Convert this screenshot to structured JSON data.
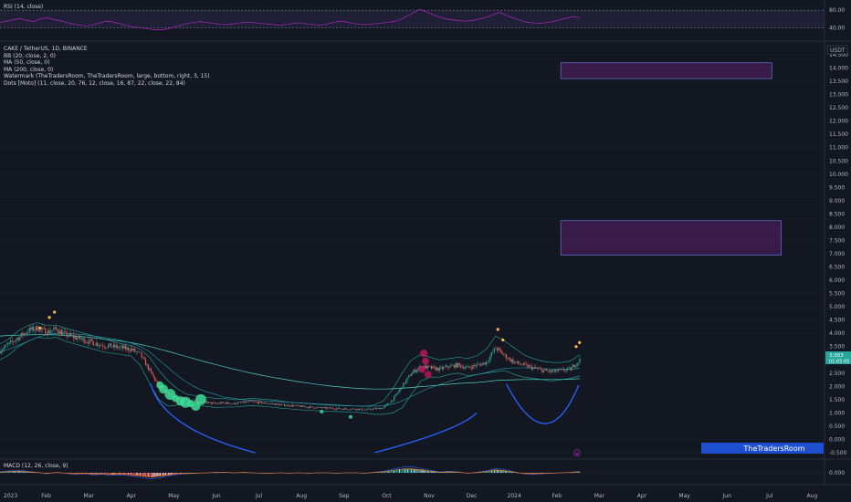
{
  "colors": {
    "bg": "#131722",
    "text": "#b2b5be",
    "up": "#26a69a",
    "down": "#ef5350",
    "rsi_line": "#9c27b0",
    "rsi_band": "#7e57c2",
    "bb": "#26a69a",
    "ma": "#2196f3",
    "zone": "#9c27b0",
    "watermark_bg": "#1e4fd0"
  },
  "rsi": {
    "title": "RSI (14, close)",
    "scale": [
      "80.00",
      "40.00"
    ],
    "upper": 80,
    "lower": 40,
    "values": [
      52,
      55,
      58,
      61,
      57,
      54,
      60,
      63,
      59,
      56,
      52,
      48,
      46,
      44,
      47,
      51,
      55,
      53,
      49,
      45,
      42,
      40,
      38,
      36,
      35,
      37,
      41,
      45,
      49,
      52,
      54,
      52,
      50,
      48,
      47,
      49,
      51,
      53,
      52,
      50,
      49,
      47,
      46,
      48,
      50,
      51,
      49,
      47,
      46,
      48,
      52,
      55,
      53,
      50,
      48,
      47,
      49,
      50,
      52,
      54,
      58,
      66,
      74,
      82,
      76,
      70,
      64,
      60,
      58,
      56,
      55,
      57,
      60,
      64,
      70,
      75,
      68,
      62,
      57,
      53,
      51,
      50,
      52,
      54,
      58,
      62,
      65,
      63
    ]
  },
  "price_pane": {
    "symbol": "CAKE / TetherUS, 1D, BINANCE",
    "indicators": [
      "BB (20, close, 2, 0)",
      "MA (50, close, 0)",
      "MA (200, close, 0)",
      "Watermark (TheTradersRoom, TheTradersRoom, large, bottom, right, 3, 15)",
      "Dots [Moto] (11, close, 20, 76, 12, close, 16, 87, 22, close, 22, 84)"
    ],
    "currency": "USDT",
    "price_ticks": [
      "14.500",
      "14.000",
      "13.500",
      "13.000",
      "12.500",
      "12.000",
      "11.500",
      "11.000",
      "10.500",
      "10.000",
      "9.500",
      "9.000",
      "8.500",
      "8.000",
      "7.500",
      "7.000",
      "6.500",
      "6.000",
      "5.500",
      "5.000",
      "4.500",
      "4.000",
      "3.500",
      "3.000",
      "2.500",
      "2.000",
      "1.500",
      "1.000",
      "0.500",
      "0.000",
      "-0.500"
    ],
    "last_price": "3.003",
    "countdown": "01:05:05",
    "watermark": "TheTradersRoom"
  },
  "macd": {
    "title": "MACD (12, 26, close, 9)",
    "scale": [
      "0.000"
    ]
  },
  "x_axis": {
    "labels": [
      "2023",
      "Feb",
      "Mar",
      "Apr",
      "May",
      "Jun",
      "Jul",
      "Aug",
      "Sep",
      "Oct",
      "Nov",
      "Dec",
      "2024",
      "Feb",
      "Mar",
      "Apr",
      "May",
      "Jun",
      "Jul",
      "Aug"
    ]
  },
  "chart_data": {
    "type": "candlestick",
    "symbol": "CAKE / TetherUS",
    "interval": "1D",
    "exchange": "BINANCE",
    "ylim": [
      -0.6,
      14.6
    ],
    "x_ticks": [
      "2023",
      "Feb",
      "Mar",
      "Apr",
      "May",
      "Jun",
      "Jul",
      "Aug",
      "Sep",
      "Oct",
      "Nov",
      "Dec",
      "2024",
      "Feb",
      "Mar",
      "Apr",
      "May",
      "Jun",
      "Jul",
      "Aug"
    ],
    "close_weekly": [
      3.35,
      3.6,
      3.85,
      4.1,
      4.2,
      4.05,
      4.15,
      3.95,
      3.85,
      3.75,
      3.65,
      3.55,
      3.5,
      3.45,
      3.4,
      3.2,
      2.6,
      2.0,
      1.7,
      1.6,
      1.5,
      1.45,
      1.4,
      1.35,
      1.38,
      1.35,
      1.4,
      1.42,
      1.38,
      1.35,
      1.3,
      1.28,
      1.25,
      1.22,
      1.2,
      1.18,
      1.17,
      1.15,
      1.15,
      1.12,
      1.15,
      1.2,
      1.5,
      2.0,
      2.5,
      2.75,
      2.7,
      2.65,
      2.75,
      2.8,
      2.7,
      2.8,
      2.9,
      3.45,
      3.15,
      2.9,
      2.8,
      2.7,
      2.6,
      2.55,
      2.6,
      2.65,
      3.0
    ],
    "bb_upper_weekly": [
      3.6,
      3.8,
      4.1,
      4.3,
      4.4,
      4.3,
      4.3,
      4.2,
      4.1,
      4.0,
      3.9,
      3.8,
      3.7,
      3.6,
      3.55,
      3.4,
      3.1,
      2.6,
      2.2,
      1.9,
      1.7,
      1.65,
      1.6,
      1.55,
      1.55,
      1.5,
      1.52,
      1.55,
      1.52,
      1.5,
      1.45,
      1.4,
      1.38,
      1.35,
      1.32,
      1.3,
      1.28,
      1.27,
      1.26,
      1.25,
      1.3,
      1.45,
      1.9,
      2.5,
      3.0,
      3.2,
      3.1,
      3.0,
      3.05,
      3.1,
      3.05,
      3.15,
      3.4,
      3.9,
      3.7,
      3.45,
      3.2,
      3.05,
      2.95,
      2.9,
      2.9,
      2.95,
      3.2
    ],
    "bb_lower_weekly": [
      3.0,
      3.2,
      3.5,
      3.7,
      3.85,
      3.8,
      3.85,
      3.7,
      3.6,
      3.5,
      3.4,
      3.3,
      3.25,
      3.2,
      3.15,
      2.8,
      2.1,
      1.5,
      1.25,
      1.3,
      1.3,
      1.28,
      1.25,
      1.2,
      1.22,
      1.22,
      1.25,
      1.28,
      1.25,
      1.22,
      1.18,
      1.15,
      1.12,
      1.1,
      1.08,
      1.06,
      1.05,
      1.04,
      1.03,
      1.0,
      0.95,
      0.95,
      1.0,
      1.2,
      1.7,
      2.2,
      2.35,
      2.35,
      2.45,
      2.5,
      2.4,
      2.45,
      2.5,
      2.55,
      2.6,
      2.45,
      2.35,
      2.3,
      2.25,
      2.2,
      2.25,
      2.3,
      2.4
    ],
    "ma50_weekly": [
      3.3,
      3.4,
      3.55,
      3.7,
      3.85,
      3.95,
      4.0,
      4.0,
      3.98,
      3.95,
      3.9,
      3.85,
      3.8,
      3.72,
      3.64,
      3.5,
      3.3,
      3.0,
      2.7,
      2.4,
      2.15,
      1.95,
      1.8,
      1.7,
      1.6,
      1.55,
      1.5,
      1.48,
      1.46,
      1.44,
      1.42,
      1.4,
      1.38,
      1.36,
      1.34,
      1.32,
      1.3,
      1.28,
      1.26,
      1.25,
      1.25,
      1.27,
      1.33,
      1.45,
      1.62,
      1.8,
      1.95,
      2.07,
      2.18,
      2.28,
      2.36,
      2.44,
      2.52,
      2.62,
      2.68,
      2.7,
      2.7,
      2.69,
      2.67,
      2.65,
      2.64,
      2.64,
      2.68
    ],
    "ma200_weekly": [
      3.9,
      3.92,
      3.93,
      3.94,
      3.95,
      3.95,
      3.94,
      3.92,
      3.9,
      3.87,
      3.83,
      3.79,
      3.75,
      3.7,
      3.65,
      3.58,
      3.5,
      3.41,
      3.32,
      3.22,
      3.12,
      3.02,
      2.92,
      2.83,
      2.74,
      2.65,
      2.57,
      2.49,
      2.42,
      2.35,
      2.29,
      2.23,
      2.17,
      2.12,
      2.07,
      2.03,
      1.99,
      1.96,
      1.93,
      1.91,
      1.9,
      1.9,
      1.91,
      1.93,
      1.96,
      1.99,
      2.02,
      2.05,
      2.08,
      2.11,
      2.13,
      2.15,
      2.18,
      2.22,
      2.24,
      2.25,
      2.26,
      2.26,
      2.26,
      2.26,
      2.26,
      2.27,
      2.29
    ],
    "zones": [
      {
        "x_from": 0.659,
        "x_to": 0.907,
        "y_low": 13.6,
        "y_high": 14.2
      },
      {
        "x_from": 0.659,
        "x_to": 0.918,
        "y_low": 6.95,
        "y_high": 8.25
      }
    ],
    "arcs": [
      {
        "points": [
          [
            0.177,
            2.1
          ],
          [
            0.215,
            0.6
          ],
          [
            0.3,
            -0.5
          ]
        ]
      },
      {
        "points": [
          [
            0.44,
            -0.5
          ],
          [
            0.52,
            0.3
          ],
          [
            0.56,
            1.0
          ]
        ]
      },
      {
        "points": [
          [
            0.595,
            2.1
          ],
          [
            0.64,
            0.6
          ],
          [
            0.68,
            2.05
          ]
        ]
      }
    ],
    "green_dots": [
      {
        "x": 0.188,
        "y": 2.05
      },
      {
        "x": 0.192,
        "y": 1.9
      },
      {
        "x": 0.2,
        "y": 1.7
      },
      {
        "x": 0.206,
        "y": 1.55
      },
      {
        "x": 0.212,
        "y": 1.45
      },
      {
        "x": 0.218,
        "y": 1.4
      },
      {
        "x": 0.224,
        "y": 1.35
      },
      {
        "x": 0.23,
        "y": 1.25
      },
      {
        "x": 0.236,
        "y": 1.5
      },
      {
        "x": 0.378,
        "y": 1.05
      },
      {
        "x": 0.412,
        "y": 0.85
      }
    ],
    "red_dots": [
      {
        "x": 0.498,
        "y": 3.25
      },
      {
        "x": 0.5,
        "y": 2.95
      },
      {
        "x": 0.496,
        "y": 2.65
      },
      {
        "x": 0.503,
        "y": 2.45
      }
    ],
    "orange_dots": [
      {
        "x": 0.047,
        "y": 4.2
      },
      {
        "x": 0.058,
        "y": 4.6
      },
      {
        "x": 0.064,
        "y": 4.8
      },
      {
        "x": 0.585,
        "y": 4.15
      },
      {
        "x": 0.591,
        "y": 3.75
      },
      {
        "x": 0.677,
        "y": 3.5
      },
      {
        "x": 0.681,
        "y": 3.65
      }
    ],
    "macd_hist_weekly": [
      0.02,
      0.04,
      0.05,
      0.03,
      0.01,
      -0.02,
      0.01,
      -0.01,
      -0.03,
      -0.02,
      -0.04,
      -0.03,
      -0.05,
      -0.04,
      -0.06,
      -0.09,
      -0.12,
      -0.1,
      -0.06,
      -0.03,
      -0.02,
      -0.01,
      0.0,
      0.01,
      0.01,
      0.0,
      0.01,
      0.0,
      -0.01,
      -0.01,
      0.0,
      -0.01,
      0.0,
      -0.01,
      0.0,
      0.0,
      -0.01,
      0.0,
      0.0,
      -0.01,
      0.01,
      0.03,
      0.07,
      0.11,
      0.12,
      0.09,
      0.05,
      0.02,
      0.03,
      0.02,
      -0.01,
      0.01,
      0.04,
      0.09,
      0.06,
      0.02,
      -0.02,
      -0.03,
      -0.02,
      -0.01,
      0.0,
      0.01,
      0.03
    ]
  }
}
